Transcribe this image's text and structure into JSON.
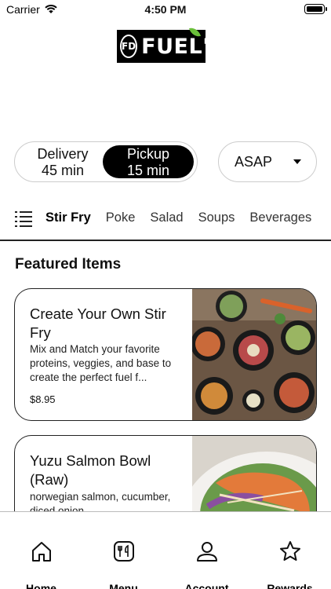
{
  "status_bar": {
    "carrier": "Carrier",
    "time": "4:50 PM"
  },
  "logo": {
    "mark": "FD",
    "text": "FUEL'D"
  },
  "order_mode": {
    "delivery_label": "Delivery",
    "delivery_time": "45 min",
    "pickup_label": "Pickup",
    "pickup_time": "15 min",
    "selected": "Pickup"
  },
  "time_select": {
    "value": "ASAP"
  },
  "categories": {
    "items": [
      "Stir Fry",
      "Poke",
      "Salad",
      "Soups",
      "Beverages"
    ],
    "active": "Stir Fry"
  },
  "featured": {
    "title": "Featured Items",
    "items": [
      {
        "title": "Create Your Own Stir Fry",
        "description": "Mix and Match your favorite proteins, veggies, and base to create the perfect fuel f...",
        "price": "$8.95"
      },
      {
        "title": "Yuzu Salmon Bowl (Raw)",
        "description": "norwegian salmon, cucumber, diced onion,"
      }
    ]
  },
  "tab_bar": {
    "items": [
      {
        "label": "Home",
        "icon": "home-icon"
      },
      {
        "label": "Menu",
        "icon": "utensils-icon"
      },
      {
        "label": "Account",
        "icon": "person-icon"
      },
      {
        "label": "Rewards",
        "icon": "star-icon"
      }
    ]
  },
  "colors": {
    "accent": "#000000",
    "leaf": "#6abf3a",
    "border": "#cccccc"
  }
}
